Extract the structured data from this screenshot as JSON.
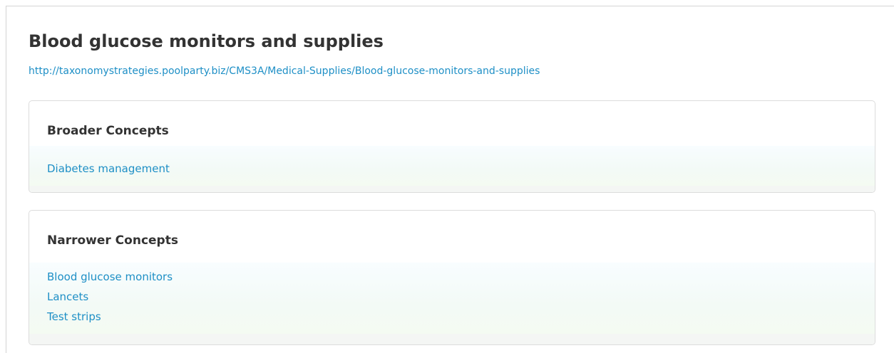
{
  "concept": {
    "title": "Blood glucose monitors and supplies",
    "uri": "http://taxonomystrategies.poolparty.biz/CMS3A/Medical-Supplies/Blood-glucose-monitors-and-supplies"
  },
  "broader": {
    "heading": "Broader Concepts",
    "items": [
      "Diabetes management"
    ]
  },
  "narrower": {
    "heading": "Narrower Concepts",
    "items": [
      "Blood glucose monitors",
      "Lancets",
      "Test strips"
    ]
  },
  "colors": {
    "link": "#1e8fc6",
    "heading": "#333333",
    "panel_border": "#dcdcdc"
  }
}
